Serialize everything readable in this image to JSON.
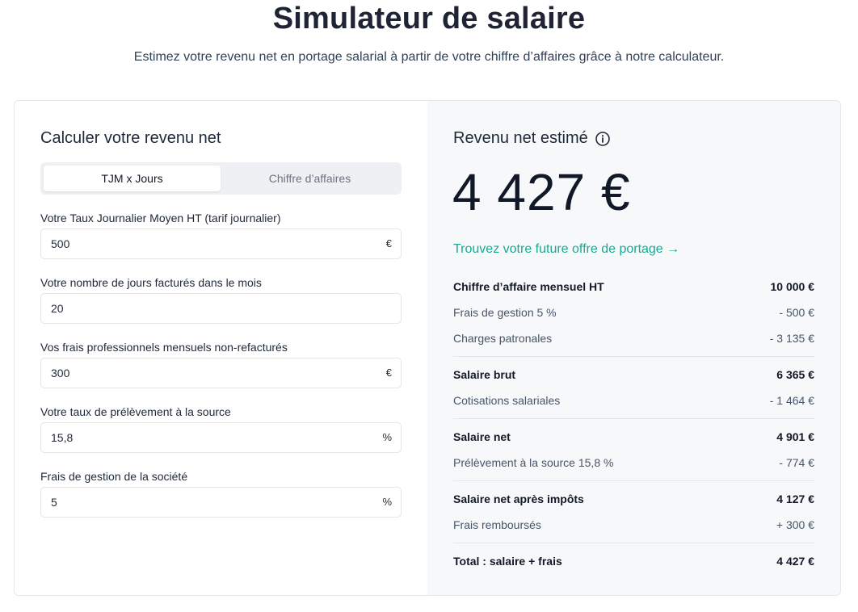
{
  "hero": {
    "title": "Simulateur de salaire",
    "subtitle": "Estimez votre revenu net en portage salarial à partir de votre chiffre d’affaires grâce à notre calculateur."
  },
  "calculator": {
    "heading": "Calculer votre revenu net",
    "tabs": [
      {
        "label": "TJM x Jours",
        "active": true
      },
      {
        "label": "Chiffre d’affaires",
        "active": false
      }
    ],
    "fields": [
      {
        "label": "Votre Taux Journalier Moyen HT (tarif journalier)",
        "value": "500",
        "unit": "€"
      },
      {
        "label": "Votre nombre de jours facturés dans le mois",
        "value": "20",
        "unit": ""
      },
      {
        "label": "Vos frais professionnels mensuels non-refacturés",
        "value": "300",
        "unit": "€"
      },
      {
        "label": "Votre taux de prélèvement à la source",
        "value": "15,8",
        "unit": "%"
      },
      {
        "label": "Frais de gestion de la société",
        "value": "5",
        "unit": "%"
      }
    ]
  },
  "result": {
    "heading": "Revenu net estimé",
    "amount": "4 427 €",
    "offer_link": "Trouvez votre future offre de portage →",
    "breakdown": [
      {
        "label": "Chiffre d’affaire mensuel HT",
        "amount": "10 000 €",
        "kind": "main"
      },
      {
        "label": "Frais de gestion 5 %",
        "amount": "- 500 €",
        "kind": "sub"
      },
      {
        "label": "Charges patronales",
        "amount": "- 3 135 €",
        "kind": "sub"
      },
      {
        "kind": "divider"
      },
      {
        "label": "Salaire brut",
        "amount": "6 365 €",
        "kind": "main"
      },
      {
        "label": "Cotisations salariales",
        "amount": "- 1 464 €",
        "kind": "sub"
      },
      {
        "kind": "divider"
      },
      {
        "label": "Salaire net",
        "amount": "4 901 €",
        "kind": "main"
      },
      {
        "label": "Prélèvement à la source 15,8 %",
        "amount": "- 774 €",
        "kind": "sub"
      },
      {
        "kind": "divider"
      },
      {
        "label": "Salaire net après impôts",
        "amount": "4 127 €",
        "kind": "main"
      },
      {
        "label": "Frais remboursés",
        "amount": "+ 300 €",
        "kind": "sub"
      },
      {
        "kind": "divider"
      },
      {
        "label": "Total : salaire + frais",
        "amount": "4 427 €",
        "kind": "main"
      }
    ]
  },
  "colors": {
    "accent": "#1aa992",
    "right_panel_bg": "#f7f8fa",
    "text_dark": "#111827"
  },
  "icons": {
    "info": "info-icon"
  }
}
